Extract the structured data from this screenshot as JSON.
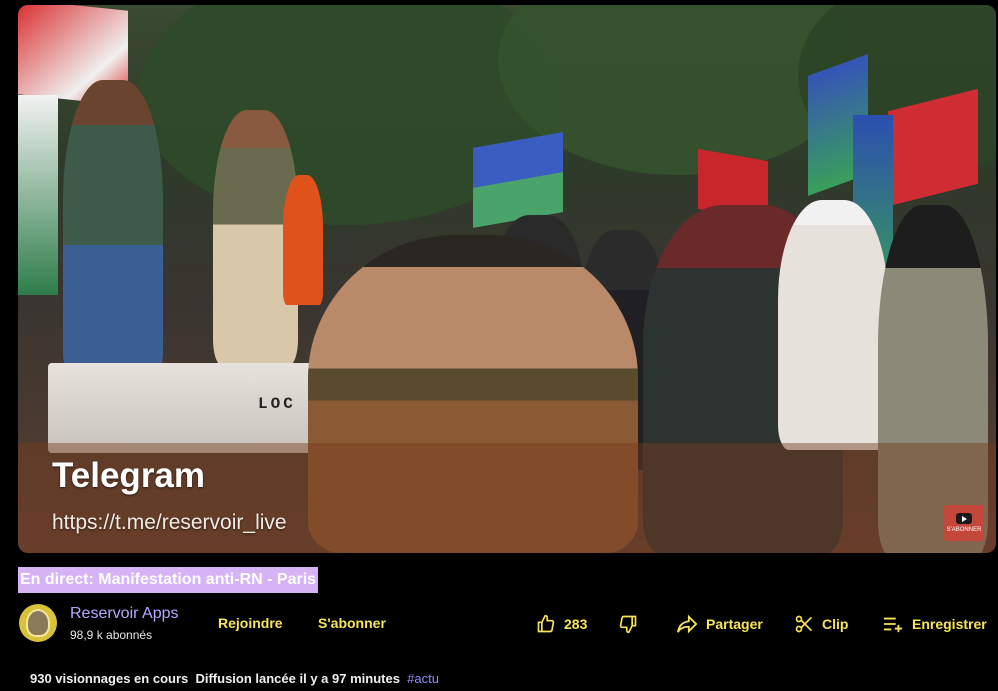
{
  "video": {
    "overlay_title": "Telegram",
    "overlay_link": "https://t.me/reservoir_live",
    "truck_text": "LOC",
    "subscribe_badge_text": "S'ABONNER"
  },
  "title": "En direct: Manifestation anti-RN - Paris",
  "channel": {
    "name": "Reservoir Apps",
    "subscribers": "98,9 k abonnés"
  },
  "buttons": {
    "join": "Rejoindre",
    "subscribe": "S'abonner"
  },
  "actions": {
    "like_count": "283",
    "share": "Partager",
    "clip": "Clip",
    "save": "Enregistrer"
  },
  "meta": {
    "views": "930 visionnages en cours",
    "started": "Diffusion lancée il y a 97 minutes",
    "hashtag": "#actu"
  },
  "colors": {
    "background": "#000000",
    "title_highlight": "#d5b3f5",
    "channel_name": "#b7a8ff",
    "accent_yellow": "#f7e45a",
    "hashtag": "#8f8cff"
  }
}
